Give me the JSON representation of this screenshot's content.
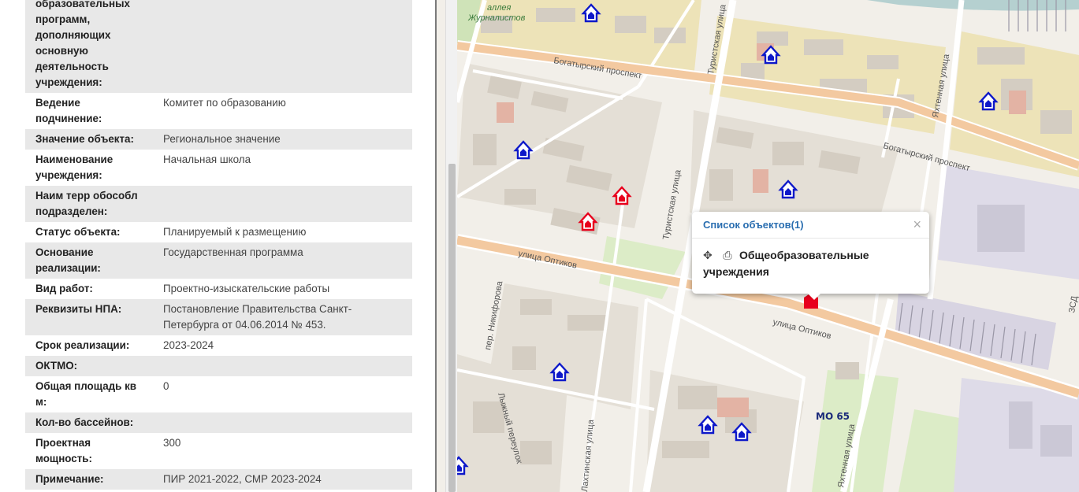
{
  "attributes": [
    {
      "label": "образовательных программ, дополняющих основную деятельность учреждения:",
      "value": "",
      "shaded": true
    },
    {
      "label": "Ведение подчинение:",
      "value": "Комитет по образованию",
      "shaded": false
    },
    {
      "label": "Значение объекта:",
      "value": "Региональное значение",
      "shaded": true
    },
    {
      "label": "Наименование учреждения:",
      "value": "Начальная школа",
      "shaded": false
    },
    {
      "label": "Наим терр обособл подразделен:",
      "value": "",
      "shaded": true
    },
    {
      "label": "Статус объекта:",
      "value": "Планируемый к размещению",
      "shaded": false
    },
    {
      "label": "Основание реализации:",
      "value": "Государственная программа",
      "shaded": true
    },
    {
      "label": "Вид работ:",
      "value": "Проектно-изыскательские работы",
      "shaded": false
    },
    {
      "label": "Реквизиты НПА:",
      "value": "Постановление Правительства Санкт-Петербурга от 04.06.2014 № 453.",
      "shaded": true
    },
    {
      "label": "Срок реализации:",
      "value": "2023-2024",
      "shaded": false
    },
    {
      "label": "ОКТМО:",
      "value": "",
      "shaded": true
    },
    {
      "label": "Общая площадь кв м:",
      "value": "0",
      "shaded": false
    },
    {
      "label": "Кол-во бассейнов:",
      "value": "",
      "shaded": true
    },
    {
      "label": "Проектная мощность:",
      "value": "300",
      "shaded": false
    },
    {
      "label": "Примечание:",
      "value": "ПИР 2021-2022, СМР 2023-2024",
      "shaded": true
    }
  ],
  "map": {
    "street_labels": {
      "alley": "аллея",
      "journalists": "Журналистов",
      "bogatyrsky_1": "Богатырский проспект",
      "bogatyrsky_2": "Богатырский проспект",
      "turistskaya_1": "Туристская улица",
      "turistskaya_2": "Туристская улица",
      "optikov_1": "улица Оптиков",
      "optikov_2": "улица Оптиков",
      "yakhtennaya_1": "Яхтенная улица",
      "yakhtennaya_2": "Яхтенная улица",
      "nikiforova": "пер. Никифорова",
      "lyzhny": "Лыжный переулок",
      "lakhtinskaya": "Лахтинская улица",
      "mo": "МО 65",
      "zsd": "ЗСД"
    },
    "colors": {
      "background": "#f2efe9",
      "block": "#e2ddd4",
      "building": "#d6cfc4",
      "road": "#ffffff",
      "major_road": "#f3c9a0",
      "park": "#dcecc7",
      "planned_marker": "#e8001c",
      "existing_marker": "#0d18c9"
    }
  },
  "popup": {
    "title": "Список объектов(1)",
    "close": "×",
    "move_icon": "✥",
    "print_icon": "⎙",
    "layer_name": "Общеобразовательные учреждения"
  }
}
